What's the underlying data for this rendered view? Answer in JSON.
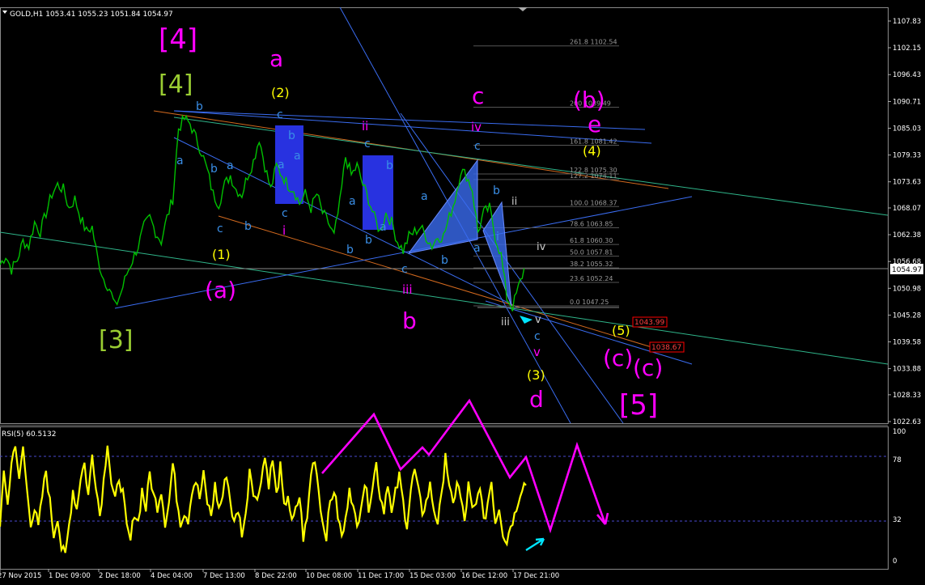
{
  "window": {
    "symbol_header": "GOLD,H1  1053.41 1055.23 1051.84 1054.97",
    "indicator_header": "RSI(5) 60.5132"
  },
  "colors": {
    "background": "#000000",
    "candles": "#00c000",
    "rsi_line": "#ffff00",
    "wave_magenta": "#ff00ff",
    "wave_olive": "#9acd32",
    "wave_yellow": "#ffff00",
    "wave_blue": "#3a8ee6",
    "fib_text": "#9a9a9a",
    "price_box": "#ffffff",
    "target_box": "#ff0000",
    "arrow_cyan": "#00e5ff",
    "pattern_fill": "#3a6cf0"
  },
  "chart_data": [
    {
      "type": "line",
      "name": "price",
      "price_axis": [
        "1107.83",
        "1102.15",
        "1096.43",
        "1090.71",
        "1085.03",
        "1079.33",
        "1073.63",
        "1068.07",
        "1062.38",
        "1056.68",
        "1050.98",
        "1045.28",
        "1039.58",
        "1033.88",
        "1028.33",
        "1022.63"
      ],
      "time_axis": [
        "27 Nov 2015",
        "1 Dec 09:00",
        "2 Dec 18:00",
        "4 Dec 04:00",
        "7 Dec 13:00",
        "8 Dec 22:00",
        "10 Dec 08:00",
        "11 Dec 17:00",
        "15 Dec 03:00",
        "16 Dec 12:00",
        "17 Dec 21:00"
      ],
      "ylim": [
        1022.63,
        1107.83
      ],
      "current_price": "1054.97",
      "target_levels": [
        "1043.99",
        "1038.67"
      ],
      "close_anchors": [
        [
          0,
          1056
        ],
        [
          3,
          1058
        ],
        [
          6,
          1055
        ],
        [
          9,
          1057
        ],
        [
          12,
          1061
        ],
        [
          15,
          1060
        ],
        [
          18,
          1065
        ],
        [
          21,
          1063
        ],
        [
          24,
          1067
        ],
        [
          27,
          1071
        ],
        [
          30,
          1073
        ],
        [
          33,
          1072
        ],
        [
          36,
          1068
        ],
        [
          39,
          1070
        ],
        [
          42,
          1066
        ],
        [
          45,
          1063
        ],
        [
          48,
          1064
        ],
        [
          51,
          1057
        ],
        [
          54,
          1053
        ],
        [
          57,
          1051
        ],
        [
          60,
          1047
        ],
        [
          63,
          1050
        ],
        [
          66,
          1054
        ],
        [
          69,
          1057
        ],
        [
          72,
          1060
        ],
        [
          75,
          1064
        ],
        [
          78,
          1066
        ],
        [
          81,
          1063
        ],
        [
          84,
          1061
        ],
        [
          87,
          1066
        ],
        [
          90,
          1070
        ],
        [
          93,
          1085
        ],
        [
          96,
          1087
        ],
        [
          99,
          1086
        ],
        [
          102,
          1083
        ],
        [
          105,
          1080
        ],
        [
          108,
          1076
        ],
        [
          111,
          1071
        ],
        [
          114,
          1069
        ],
        [
          117,
          1073
        ],
        [
          120,
          1075
        ],
        [
          123,
          1072
        ],
        [
          126,
          1071
        ],
        [
          129,
          1075
        ],
        [
          132,
          1078
        ],
        [
          135,
          1083
        ],
        [
          138,
          1077
        ],
        [
          141,
          1072
        ],
        [
          144,
          1077
        ],
        [
          147,
          1075
        ],
        [
          150,
          1073
        ],
        [
          153,
          1072
        ],
        [
          156,
          1069
        ],
        [
          159,
          1071
        ],
        [
          162,
          1068
        ],
        [
          165,
          1071
        ],
        [
          168,
          1067
        ],
        [
          171,
          1065
        ],
        [
          174,
          1062
        ],
        [
          177,
          1069
        ],
        [
          180,
          1079
        ],
        [
          183,
          1075
        ],
        [
          186,
          1077
        ],
        [
          189,
          1073
        ],
        [
          192,
          1070
        ],
        [
          195,
          1066
        ],
        [
          198,
          1063
        ],
        [
          201,
          1067
        ],
        [
          204,
          1065
        ],
        [
          207,
          1061
        ],
        [
          210,
          1059
        ],
        [
          213,
          1062
        ],
        [
          216,
          1063
        ],
        [
          219,
          1064
        ],
        [
          222,
          1062
        ],
        [
          225,
          1060
        ],
        [
          228,
          1062
        ],
        [
          231,
          1062
        ],
        [
          234,
          1066
        ],
        [
          237,
          1070
        ],
        [
          240,
          1076
        ],
        [
          243,
          1075
        ],
        [
          246,
          1072
        ],
        [
          249,
          1063
        ],
        [
          252,
          1067
        ],
        [
          255,
          1068
        ],
        [
          258,
          1062
        ],
        [
          261,
          1058
        ],
        [
          264,
          1049
        ],
        [
          267,
          1047
        ],
        [
          270,
          1051
        ],
        [
          273,
          1055
        ]
      ],
      "rsi_ylim": [
        0,
        100
      ],
      "rsi_levels": [
        "100",
        "78",
        "32",
        "0"
      ],
      "rsi_anchors": [
        [
          0,
          30
        ],
        [
          2,
          65
        ],
        [
          4,
          45
        ],
        [
          6,
          75
        ],
        [
          8,
          92
        ],
        [
          10,
          60
        ],
        [
          12,
          88
        ],
        [
          14,
          55
        ],
        [
          16,
          30
        ],
        [
          18,
          40
        ],
        [
          20,
          25
        ],
        [
          22,
          50
        ],
        [
          24,
          70
        ],
        [
          26,
          45
        ],
        [
          28,
          20
        ],
        [
          30,
          35
        ],
        [
          32,
          10
        ],
        [
          34,
          3
        ],
        [
          36,
          28
        ],
        [
          38,
          55
        ],
        [
          40,
          40
        ],
        [
          42,
          65
        ],
        [
          44,
          75
        ],
        [
          46,
          50
        ],
        [
          48,
          82
        ],
        [
          50,
          60
        ],
        [
          52,
          35
        ],
        [
          54,
          62
        ],
        [
          56,
          93
        ],
        [
          58,
          60
        ],
        [
          60,
          45
        ],
        [
          62,
          65
        ],
        [
          64,
          52
        ],
        [
          66,
          25
        ],
        [
          68,
          15
        ],
        [
          70,
          38
        ],
        [
          72,
          30
        ],
        [
          74,
          55
        ],
        [
          76,
          40
        ],
        [
          78,
          68
        ],
        [
          80,
          50
        ],
        [
          82,
          42
        ],
        [
          84,
          55
        ],
        [
          86,
          30
        ],
        [
          88,
          45
        ],
        [
          90,
          75
        ],
        [
          92,
          50
        ],
        [
          94,
          30
        ],
        [
          96,
          38
        ],
        [
          98,
          32
        ],
        [
          100,
          55
        ],
        [
          102,
          62
        ],
        [
          104,
          48
        ],
        [
          106,
          66
        ],
        [
          108,
          45
        ],
        [
          110,
          35
        ],
        [
          112,
          58
        ],
        [
          114,
          40
        ],
        [
          116,
          50
        ],
        [
          118,
          68
        ],
        [
          120,
          46
        ],
        [
          122,
          28
        ],
        [
          124,
          40
        ],
        [
          126,
          22
        ],
        [
          128,
          34
        ],
        [
          130,
          72
        ],
        [
          132,
          55
        ],
        [
          134,
          45
        ],
        [
          136,
          65
        ],
        [
          138,
          80
        ],
        [
          140,
          60
        ],
        [
          142,
          78
        ],
        [
          144,
          50
        ],
        [
          146,
          72
        ],
        [
          148,
          40
        ],
        [
          150,
          52
        ],
        [
          152,
          28
        ],
        [
          154,
          38
        ],
        [
          156,
          50
        ],
        [
          158,
          18
        ],
        [
          160,
          32
        ],
        [
          162,
          68
        ],
        [
          164,
          80
        ],
        [
          166,
          55
        ],
        [
          168,
          30
        ],
        [
          170,
          20
        ],
        [
          172,
          45
        ],
        [
          174,
          55
        ],
        [
          176,
          35
        ],
        [
          178,
          18
        ],
        [
          180,
          30
        ],
        [
          182,
          60
        ],
        [
          184,
          40
        ],
        [
          186,
          25
        ],
        [
          188,
          45
        ],
        [
          190,
          60
        ],
        [
          192,
          42
        ],
        [
          194,
          58
        ],
        [
          196,
          75
        ],
        [
          198,
          50
        ],
        [
          200,
          40
        ],
        [
          202,
          62
        ],
        [
          204,
          35
        ],
        [
          206,
          52
        ],
        [
          208,
          65
        ],
        [
          210,
          45
        ],
        [
          212,
          28
        ],
        [
          214,
          55
        ],
        [
          216,
          70
        ],
        [
          218,
          52
        ],
        [
          220,
          38
        ],
        [
          222,
          45
        ],
        [
          224,
          58
        ],
        [
          226,
          40
        ],
        [
          228,
          30
        ],
        [
          230,
          48
        ],
        [
          232,
          85
        ],
        [
          234,
          55
        ],
        [
          236,
          42
        ],
        [
          238,
          62
        ],
        [
          240,
          48
        ],
        [
          242,
          30
        ],
        [
          244,
          58
        ],
        [
          246,
          38
        ],
        [
          248,
          42
        ],
        [
          250,
          60
        ],
        [
          252,
          28
        ],
        [
          254,
          45
        ],
        [
          256,
          62
        ],
        [
          258,
          30
        ],
        [
          260,
          42
        ],
        [
          262,
          22
        ],
        [
          264,
          15
        ],
        [
          266,
          28
        ],
        [
          268,
          35
        ],
        [
          270,
          48
        ],
        [
          272,
          58
        ],
        [
          274,
          60
        ]
      ]
    }
  ],
  "wave_labels": {
    "big_4_magenta": "[4]",
    "big_4_olive": "[4]",
    "big_3_olive": "[3]",
    "big_5_magenta": "[5]",
    "a_top": "a",
    "b_bottom": "b",
    "c_top": "c",
    "d_bottom": "d",
    "e_right": "e",
    "b_paren_right": "(b)",
    "a_paren_left": "(a)",
    "c_paren_1": "(c)",
    "c_paren_2": "(c)",
    "y1": "(1)",
    "y2": "(2)",
    "y3": "(3)",
    "y4": "(4)",
    "y5": "(5)",
    "ii_m": "ii",
    "iv_m": "iv",
    "i_m": "i",
    "iii_m": "iii",
    "v_m": "v",
    "ii_w": "ii",
    "iv_w": "iv",
    "iii_w": "iii",
    "v_w": "v",
    "b1": "b",
    "a1": "a",
    "c1": "c",
    "b2": "b",
    "a2": "a",
    "c2": "c",
    "b3": "b",
    "a3": "a",
    "c3": "c",
    "b4": "b",
    "a4": "a",
    "c4": "c",
    "b5": "b",
    "a5": "a",
    "c5": "c",
    "b6": "b",
    "a6": "a",
    "c6": "c",
    "b7": "b",
    "a7": "a",
    "a8": "a",
    "i_b": "i",
    "b8": "b",
    "c7": "c",
    "b9": "b"
  },
  "fib_labels": [
    "261.8 1102.54",
    "200 1089.49",
    "161.8 1081.42",
    "127.2 1074.11",
    "122.8 1075.30",
    "100.0 1068.37",
    "78.6 1063.85",
    "61.8 1060.30",
    "50.0 1057.81",
    "38.2 1055.32",
    "23.6 1052.24",
    "0.0 1047.25"
  ]
}
